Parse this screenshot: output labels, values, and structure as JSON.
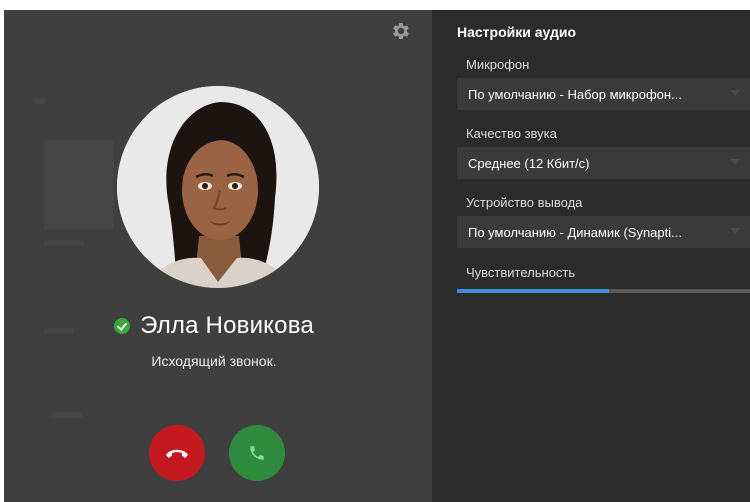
{
  "call": {
    "contact_name": "Элла Новикова",
    "status_text": "Исходящий звонок.",
    "presence": "online",
    "avatar_icon": "person-avatar",
    "decline_icon": "phone-hangup-icon",
    "accept_icon": "phone-icon",
    "settings_icon": "gear-icon",
    "colors": {
      "pane_bg": "#3f3f3f",
      "decline": "#c41a1f",
      "accept": "#2e8b3d",
      "presence": "#3aa63c"
    }
  },
  "audio_settings": {
    "title": "Настройки аудио",
    "microphone": {
      "label": "Микрофон",
      "value": "По умолчанию - Набор микрофон..."
    },
    "quality": {
      "label": "Качество звука",
      "value": "Среднее (12 Кбит/с)"
    },
    "output": {
      "label": "Устройство вывода",
      "value": "По умолчанию - Динамик (Synapti..."
    },
    "sensitivity": {
      "label": "Чувствительность",
      "level": 0.52
    },
    "colors": {
      "pane_bg": "#2b2b2b",
      "slider_fill": "#3c8fd6"
    }
  }
}
